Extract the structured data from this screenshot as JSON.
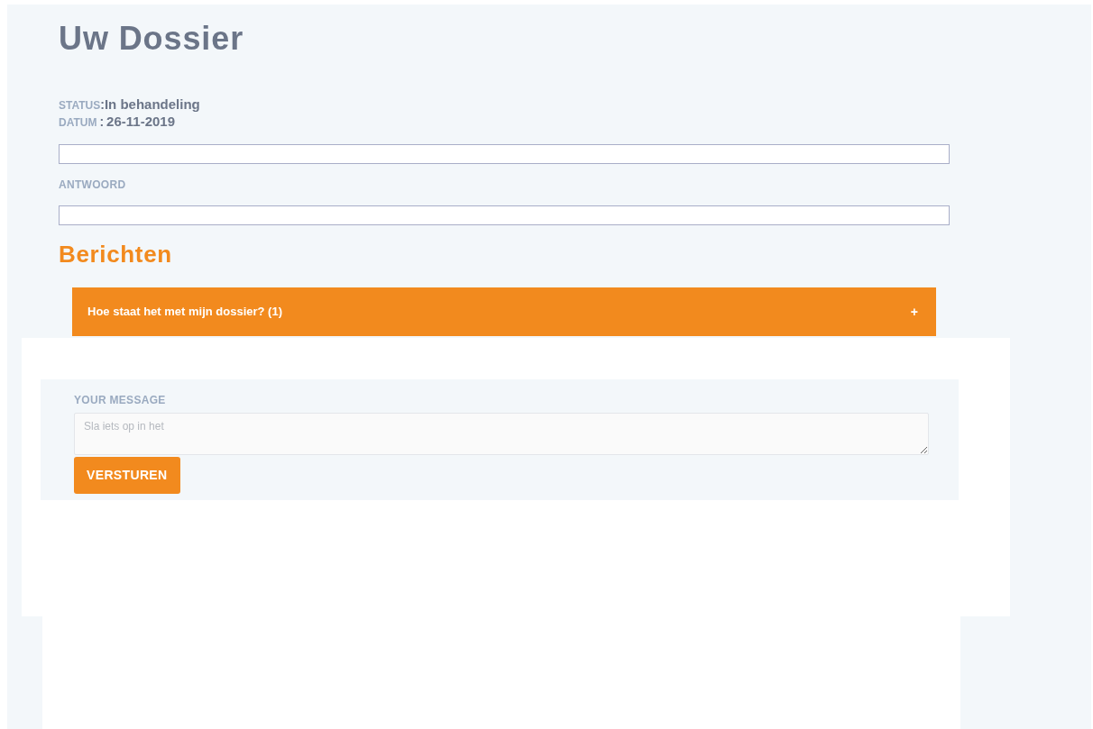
{
  "page_title": "Uw Dossier",
  "status": {
    "label": "STATUS",
    "separator": ":",
    "value": "In behandeling"
  },
  "date": {
    "label": "DATUM",
    "separator": ":",
    "value": "26-11-2019"
  },
  "answer_label": "ANTWOORD",
  "messages_heading": "Berichten",
  "accordion": {
    "title": "Hoe staat het met mijn dossier? (1)",
    "toggle": "+"
  },
  "form": {
    "label": "YOUR MESSAGE",
    "placeholder": "Sla iets op in het",
    "button": "VERSTUREN"
  }
}
